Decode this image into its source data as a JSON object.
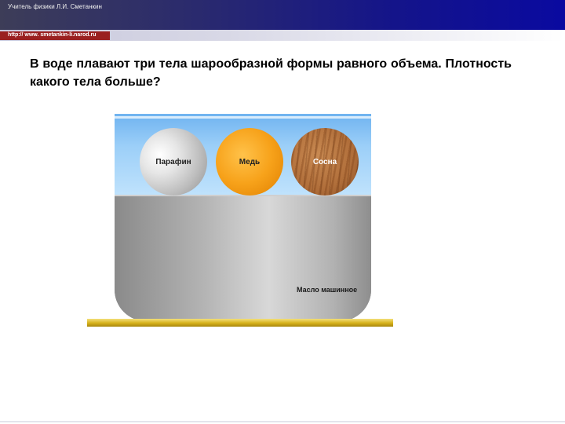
{
  "header": {
    "author": "Учитель физики Л.И. Сметанкин",
    "url": "http:// www. smetankin-li.narod.ru"
  },
  "question": {
    "text": "В воде плавают три тела шарообразной формы равного объема. Плотность какого тела больше?"
  },
  "illustration": {
    "balls": [
      {
        "label": "Парафин",
        "color": "#c8c8c8"
      },
      {
        "label": "Медь",
        "color": "#f7a21a"
      },
      {
        "label": "Сосна",
        "color": "#b06e3a"
      }
    ],
    "liquid_label": "Масло машинное",
    "water_color": "#9ccff8",
    "oil_color": "#b4b4b4"
  }
}
